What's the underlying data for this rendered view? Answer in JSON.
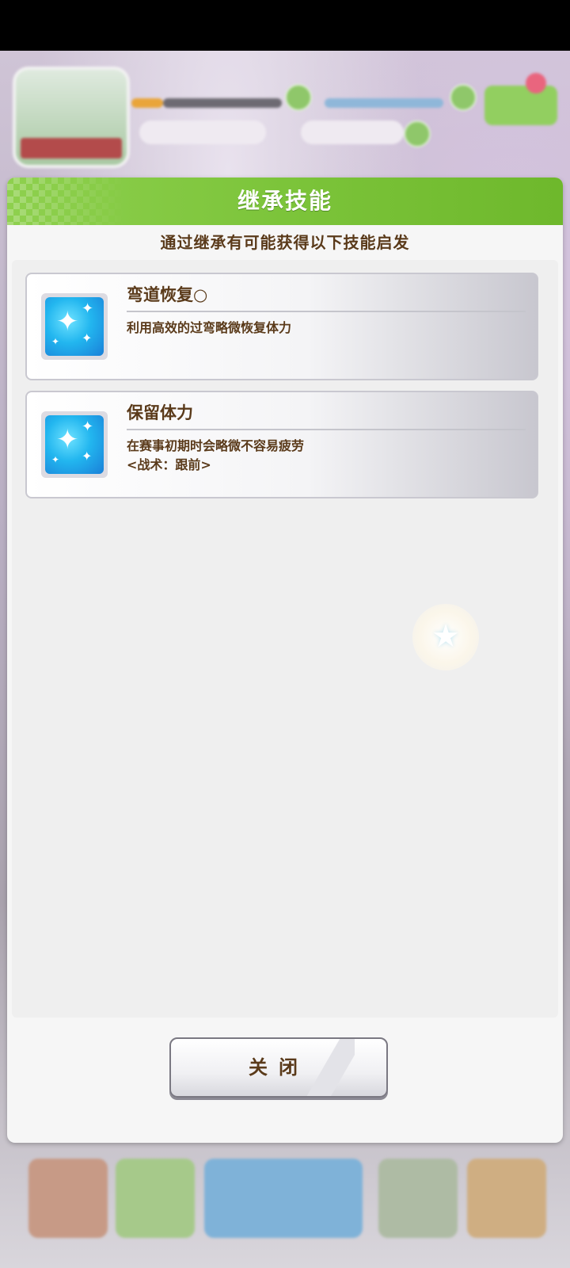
{
  "modal": {
    "title": "继承技能",
    "subtitle": "通过继承有可能获得以下技能启发",
    "skills": [
      {
        "name": "弯道恢复○",
        "description": "利用高效的过弯略微恢复体力",
        "icon": "sparkle-skill-icon"
      },
      {
        "name": "保留体力",
        "description": "在赛事初期时会略微不容易疲劳\n<战术：跟前>",
        "icon": "sparkle-skill-icon"
      }
    ],
    "close_label": "关闭"
  },
  "colors": {
    "header_green": "#7cc43a",
    "text_brown": "#5a3a1a",
    "skill_icon_blue": "#22b6ef"
  }
}
